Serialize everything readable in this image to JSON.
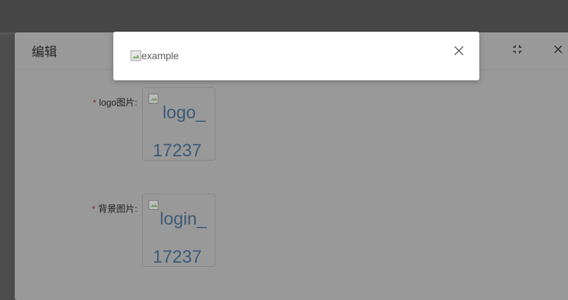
{
  "edit_dialog": {
    "title": "编辑",
    "fields": [
      {
        "label": "logo图片:",
        "required_mark": "*",
        "image_text_line1": "logo_",
        "image_text_line2": "17237"
      },
      {
        "label": "背景图片:",
        "required_mark": "*",
        "image_text_line1": "login_",
        "image_text_line2": "17237"
      }
    ],
    "icons": [
      "fullscreen-icon",
      "close-icon"
    ]
  },
  "preview_modal": {
    "image_alt": "example",
    "icons": [
      "broken-image-icon",
      "close-icon"
    ]
  }
}
